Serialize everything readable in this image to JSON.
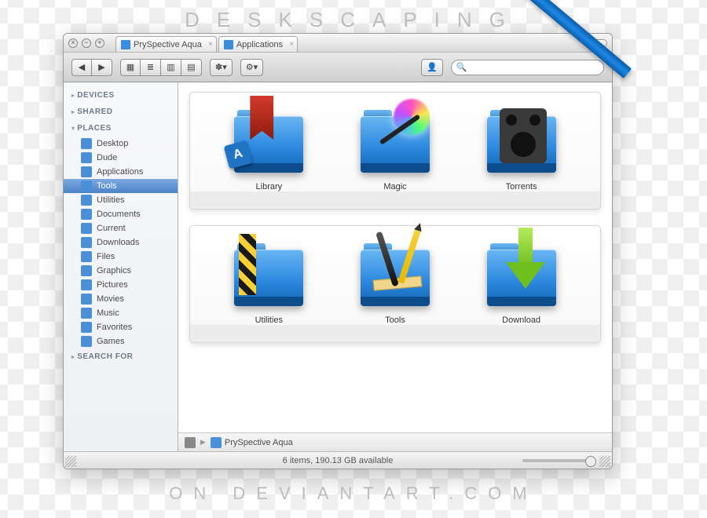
{
  "watermark": {
    "top": "DESKSCAPING",
    "bottom": "ON   DEVIANTART.COM"
  },
  "titlebar": {
    "tabs": [
      {
        "label": "PrySpective Aqua"
      },
      {
        "label": "Applications"
      }
    ]
  },
  "toolbar": {
    "nav": {
      "back": "◀",
      "fwd": "▶"
    },
    "views": {
      "icon": "▦",
      "list": "≣",
      "column": "▥",
      "cover": "▤"
    },
    "action": "✽▾",
    "gear": "⚙▾",
    "user": "👤",
    "search_placeholder": ""
  },
  "sidebar": {
    "sections": {
      "devices": "DEVICES",
      "shared": "SHARED",
      "places": "PLACES",
      "searchfor": "SEARCH FOR"
    },
    "places": [
      "Desktop",
      "Dude",
      "Applications",
      "Tools",
      "Utilities",
      "Documents",
      "Current",
      "Downloads",
      "Files",
      "Graphics",
      "Pictures",
      "Movies",
      "Music",
      "Favorites",
      "Games"
    ],
    "selected": "Tools"
  },
  "folders": [
    {
      "label": "Library",
      "overlay": "bookmark"
    },
    {
      "label": "Magic",
      "overlay": "wand"
    },
    {
      "label": "Torrents",
      "overlay": "speaker"
    },
    {
      "label": "Utilities",
      "overlay": "stripes"
    },
    {
      "label": "Tools",
      "overlay": "tools"
    },
    {
      "label": "Download",
      "overlay": "arrow"
    }
  ],
  "pathbar": {
    "root_icon": "⌂",
    "segment": "PrySpective Aqua"
  },
  "statusbar": {
    "text": "6 items, 190.13 GB available"
  },
  "search_glyph": "🔍"
}
